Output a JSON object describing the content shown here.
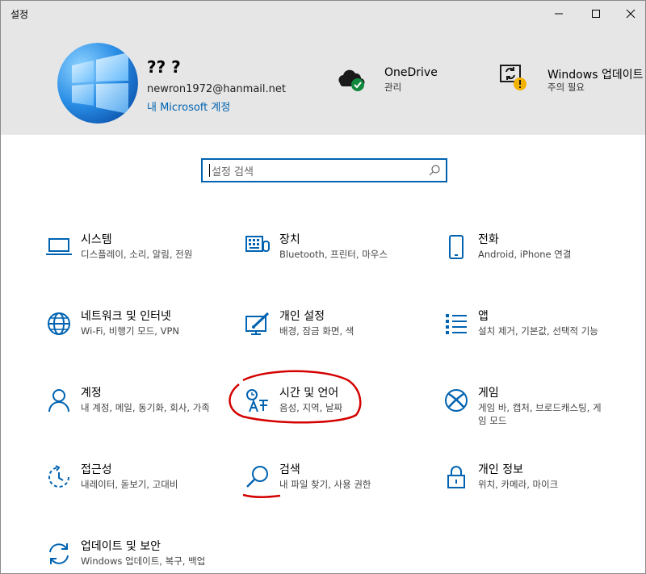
{
  "window": {
    "title": "설정",
    "controls": {
      "minimize": "minimize-icon",
      "maximize": "maximize-icon",
      "close": "close-icon"
    }
  },
  "profile": {
    "name": "?? ?",
    "email": "newron1972@hanmail.net",
    "account_link": "내 Microsoft 계정"
  },
  "header_items": [
    {
      "title": "OneDrive",
      "subtitle": "관리",
      "icon": "onedrive-icon"
    },
    {
      "title": "Windows 업데이트",
      "subtitle": "주의 필요",
      "icon": "windows-update-icon"
    }
  ],
  "search": {
    "placeholder": "설정 검색"
  },
  "categories": [
    {
      "title": "시스템",
      "subtitle": "디스플레이, 소리, 알림, 전원",
      "icon": "laptop-icon"
    },
    {
      "title": "장치",
      "subtitle": "Bluetooth, 프린터, 마우스",
      "icon": "keyboard-icon"
    },
    {
      "title": "전화",
      "subtitle": "Android, iPhone 연결",
      "icon": "phone-icon"
    },
    {
      "title": "네트워크 및 인터넷",
      "subtitle": "Wi-Fi, 비행기 모드, VPN",
      "icon": "globe-icon"
    },
    {
      "title": "개인 설정",
      "subtitle": "배경, 잠금 화면, 색",
      "icon": "personalization-icon"
    },
    {
      "title": "앱",
      "subtitle": "설치 제거, 기본값, 선택적 기능",
      "icon": "apps-list-icon"
    },
    {
      "title": "계정",
      "subtitle": "내 계정, 메일, 동기화, 회사, 가족",
      "icon": "person-icon"
    },
    {
      "title": "시간 및 언어",
      "subtitle": "음성, 지역, 날짜",
      "icon": "time-language-icon"
    },
    {
      "title": "게임",
      "subtitle": "게임 바, 캡처, 브로드캐스팅, 게임 모드",
      "icon": "xbox-icon"
    },
    {
      "title": "접근성",
      "subtitle": "내레이터, 돋보기, 고대비",
      "icon": "ease-of-access-icon"
    },
    {
      "title": "검색",
      "subtitle": "내 파일 찾기, 사용 권한",
      "icon": "search-icon"
    },
    {
      "title": "개인 정보",
      "subtitle": "위치, 카메라, 마이크",
      "icon": "lock-icon"
    },
    {
      "title": "업데이트 및 보안",
      "subtitle": "Windows 업데이트, 복구, 백업",
      "icon": "update-sync-icon"
    }
  ],
  "colors": {
    "accent": "#0063b1",
    "header_bg": "#e6e6e6",
    "annotation": "#d40000"
  }
}
